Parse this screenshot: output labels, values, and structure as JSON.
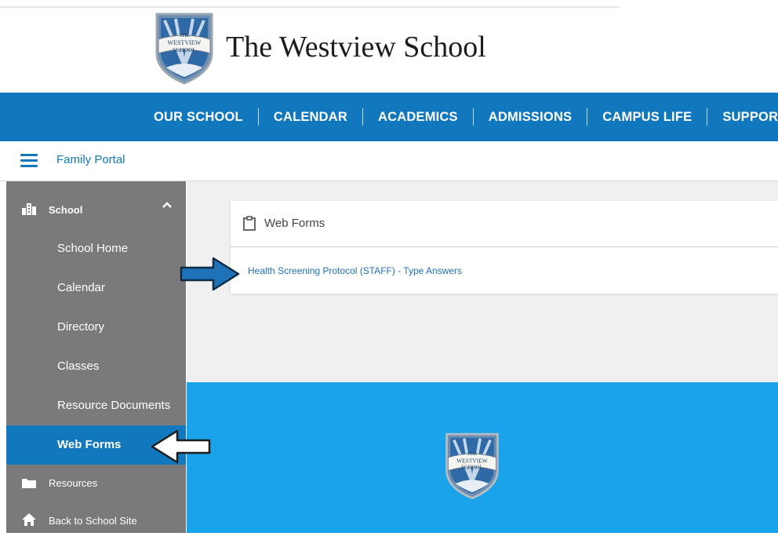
{
  "header": {
    "school_name": "The Westview School",
    "crest_text": [
      "THE",
      "WESTVIEW",
      "SCHOOL"
    ]
  },
  "nav": {
    "items": [
      "OUR SCHOOL",
      "CALENDAR",
      "ACADEMICS",
      "ADMISSIONS",
      "CAMPUS LIFE",
      "SUPPORT US"
    ]
  },
  "portal": {
    "label": "Family Portal",
    "menu_icon": "hamburger-icon"
  },
  "sidebar": {
    "section": {
      "label": "School",
      "icon": "building-icon",
      "toggle_icon": "chevron-up-icon"
    },
    "items": [
      {
        "label": "School Home"
      },
      {
        "label": "Calendar"
      },
      {
        "label": "Directory"
      },
      {
        "label": "Classes"
      },
      {
        "label": "Resource Documents"
      },
      {
        "label": "Web Forms",
        "active": true
      }
    ],
    "lower": [
      {
        "label": "Resources",
        "icon": "folder-icon"
      },
      {
        "label": "Back to School Site",
        "icon": "home-icon"
      }
    ]
  },
  "main": {
    "card_title": "Web Forms",
    "card_icon": "clipboard-icon",
    "forms": [
      {
        "label": "Health Screening Protocol (STAFF) - Type Answers"
      }
    ]
  },
  "colors": {
    "nav_blue": "#1278be",
    "sidebar_gray": "#7a7a7a",
    "footer_blue": "#1aa3ea",
    "link_blue": "#1f6fb8",
    "arrow_blue": "#1e73b8"
  }
}
